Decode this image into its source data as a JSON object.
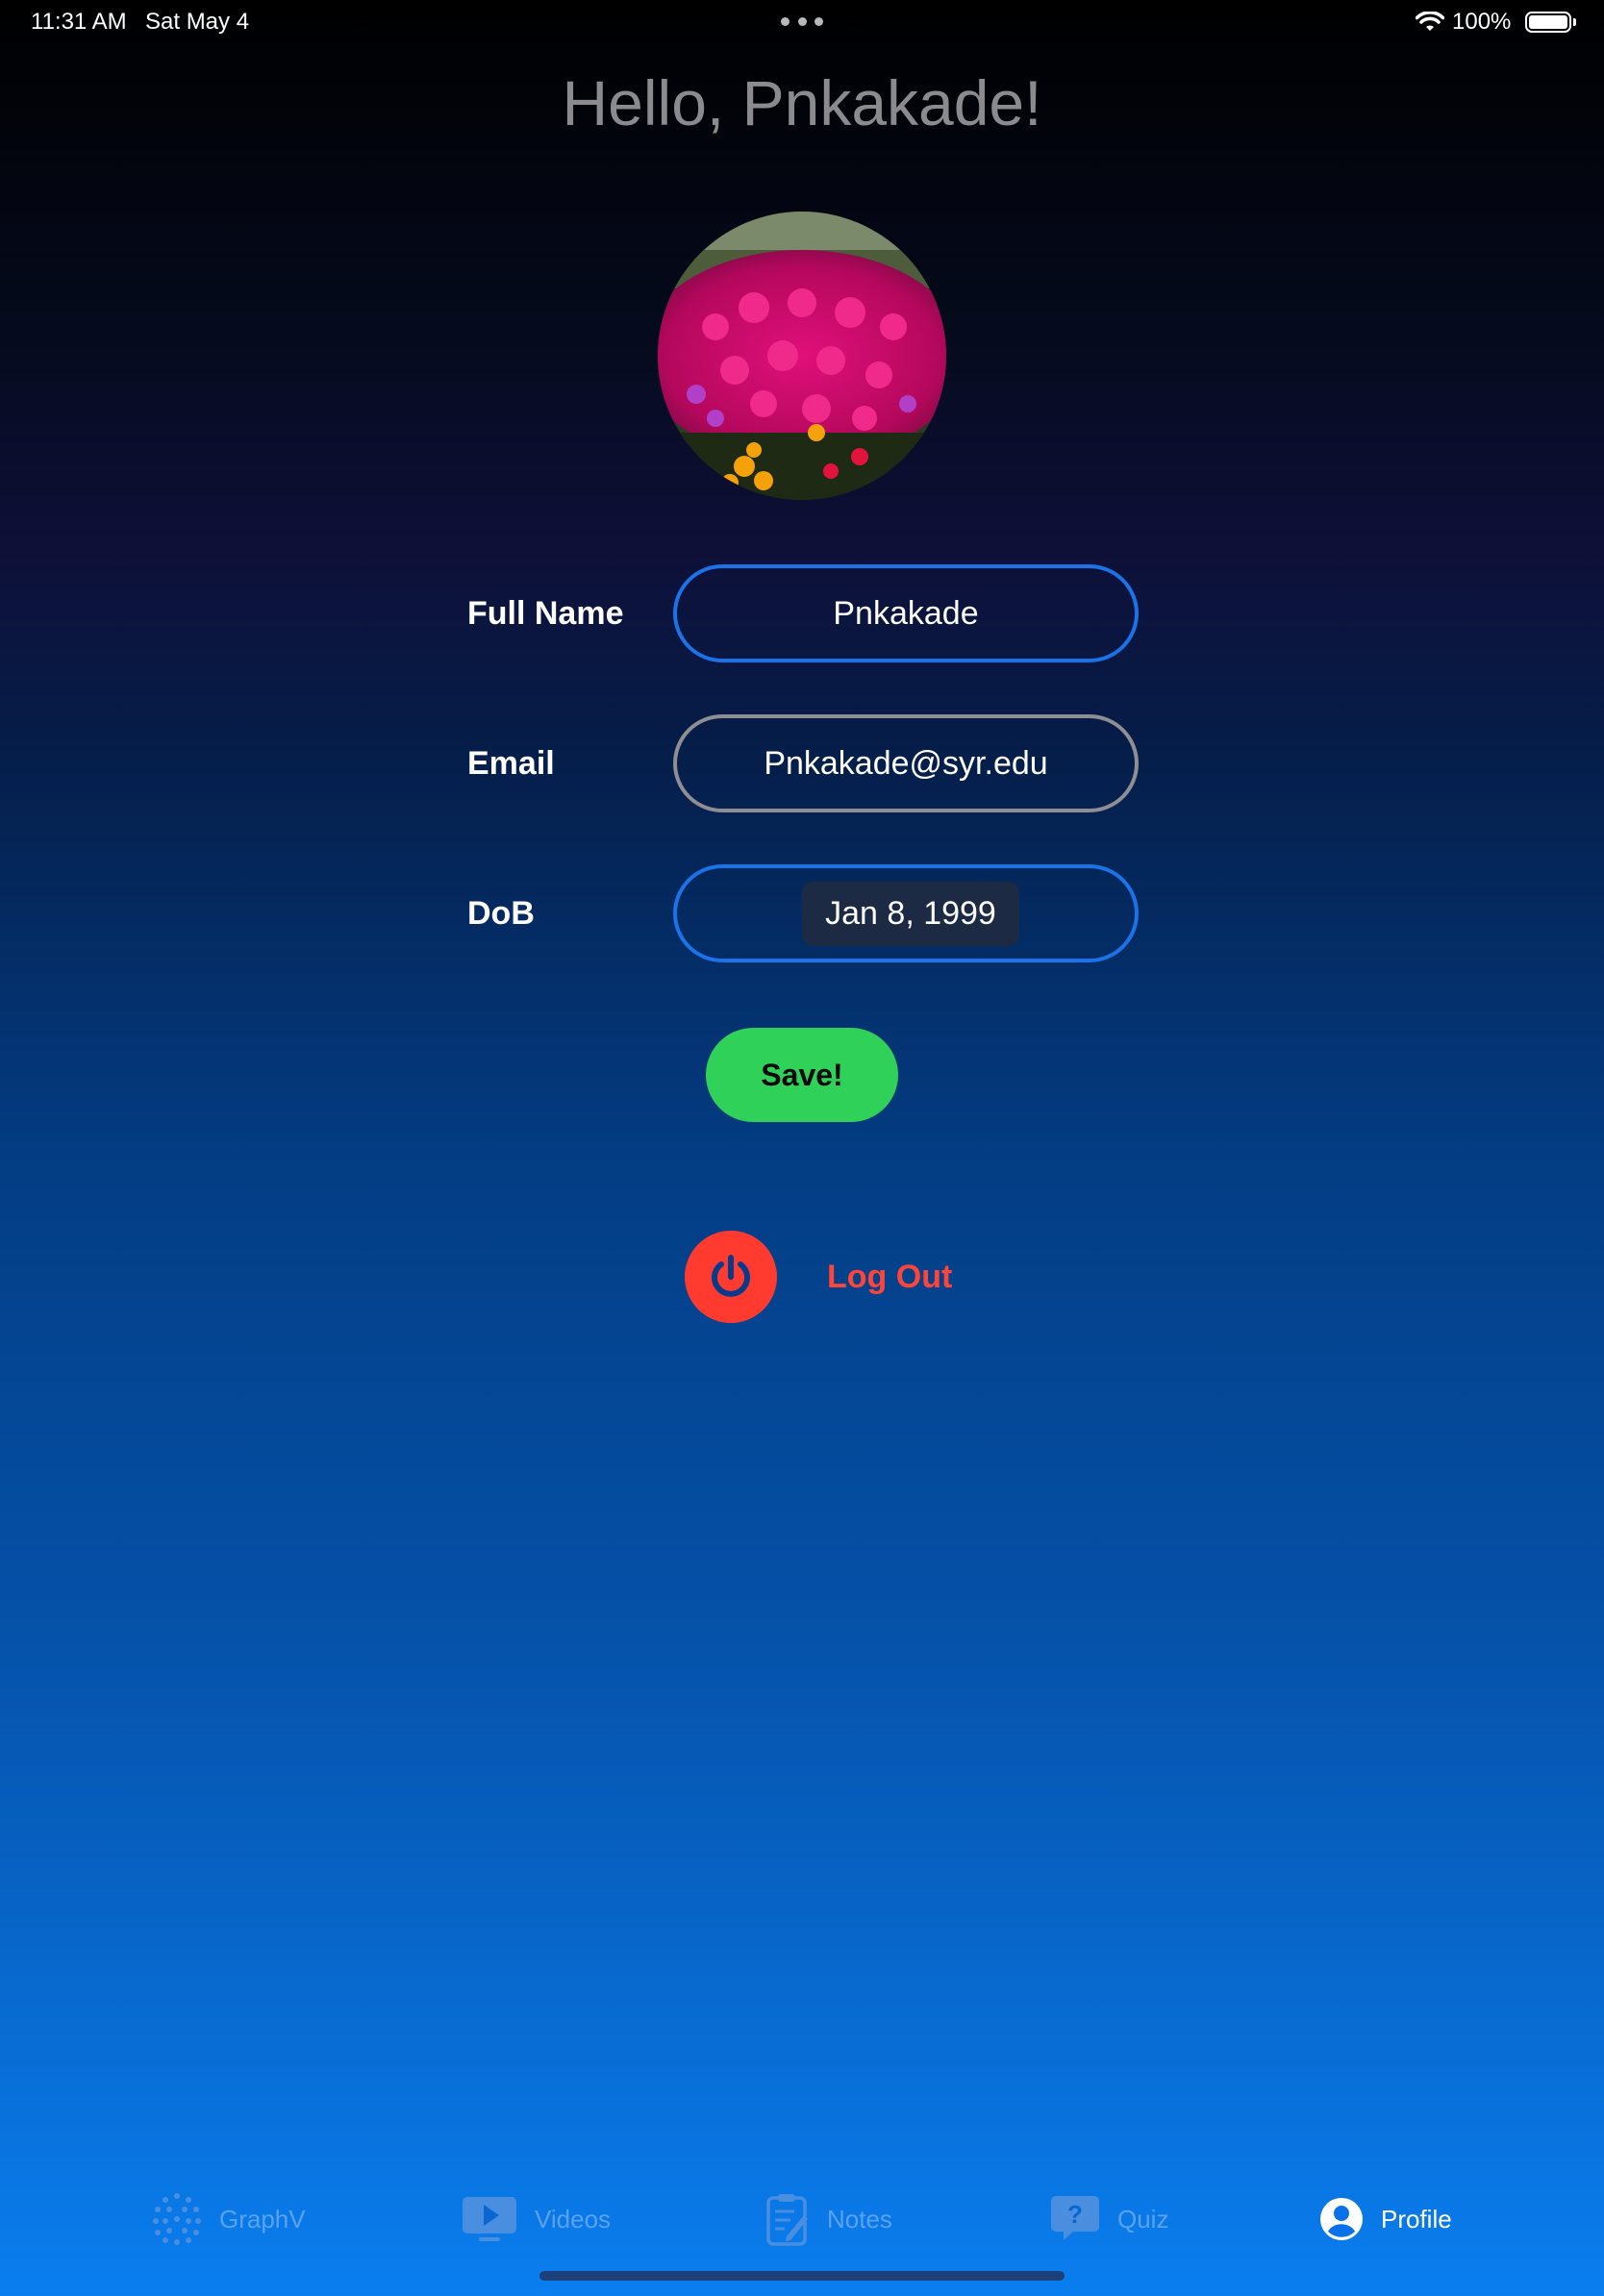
{
  "status_bar": {
    "time": "11:31 AM",
    "date": "Sat May 4",
    "battery": "100%"
  },
  "greeting": "Hello, Pnkakade!",
  "form": {
    "full_name_label": "Full Name",
    "full_name_value": "Pnkakade",
    "email_label": "Email",
    "email_value": "Pnkakade@syr.edu",
    "dob_label": "DoB",
    "dob_value": "Jan 8, 1999"
  },
  "save_label": "Save!",
  "logout_label": "Log Out",
  "tabs": [
    {
      "label": "GraphV",
      "icon": "graph-dots-icon",
      "active": false
    },
    {
      "label": "Videos",
      "icon": "video-play-icon",
      "active": false
    },
    {
      "label": "Notes",
      "icon": "notes-clipboard-icon",
      "active": false
    },
    {
      "label": "Quiz",
      "icon": "quiz-question-icon",
      "active": false
    },
    {
      "label": "Profile",
      "icon": "profile-person-icon",
      "active": true
    }
  ],
  "colors": {
    "accent_blue": "#1a73e8",
    "save_green": "#30d158",
    "logout_red": "#ff453a",
    "tab_inactive": "#5aa2ee",
    "tab_active": "#ffffff"
  }
}
